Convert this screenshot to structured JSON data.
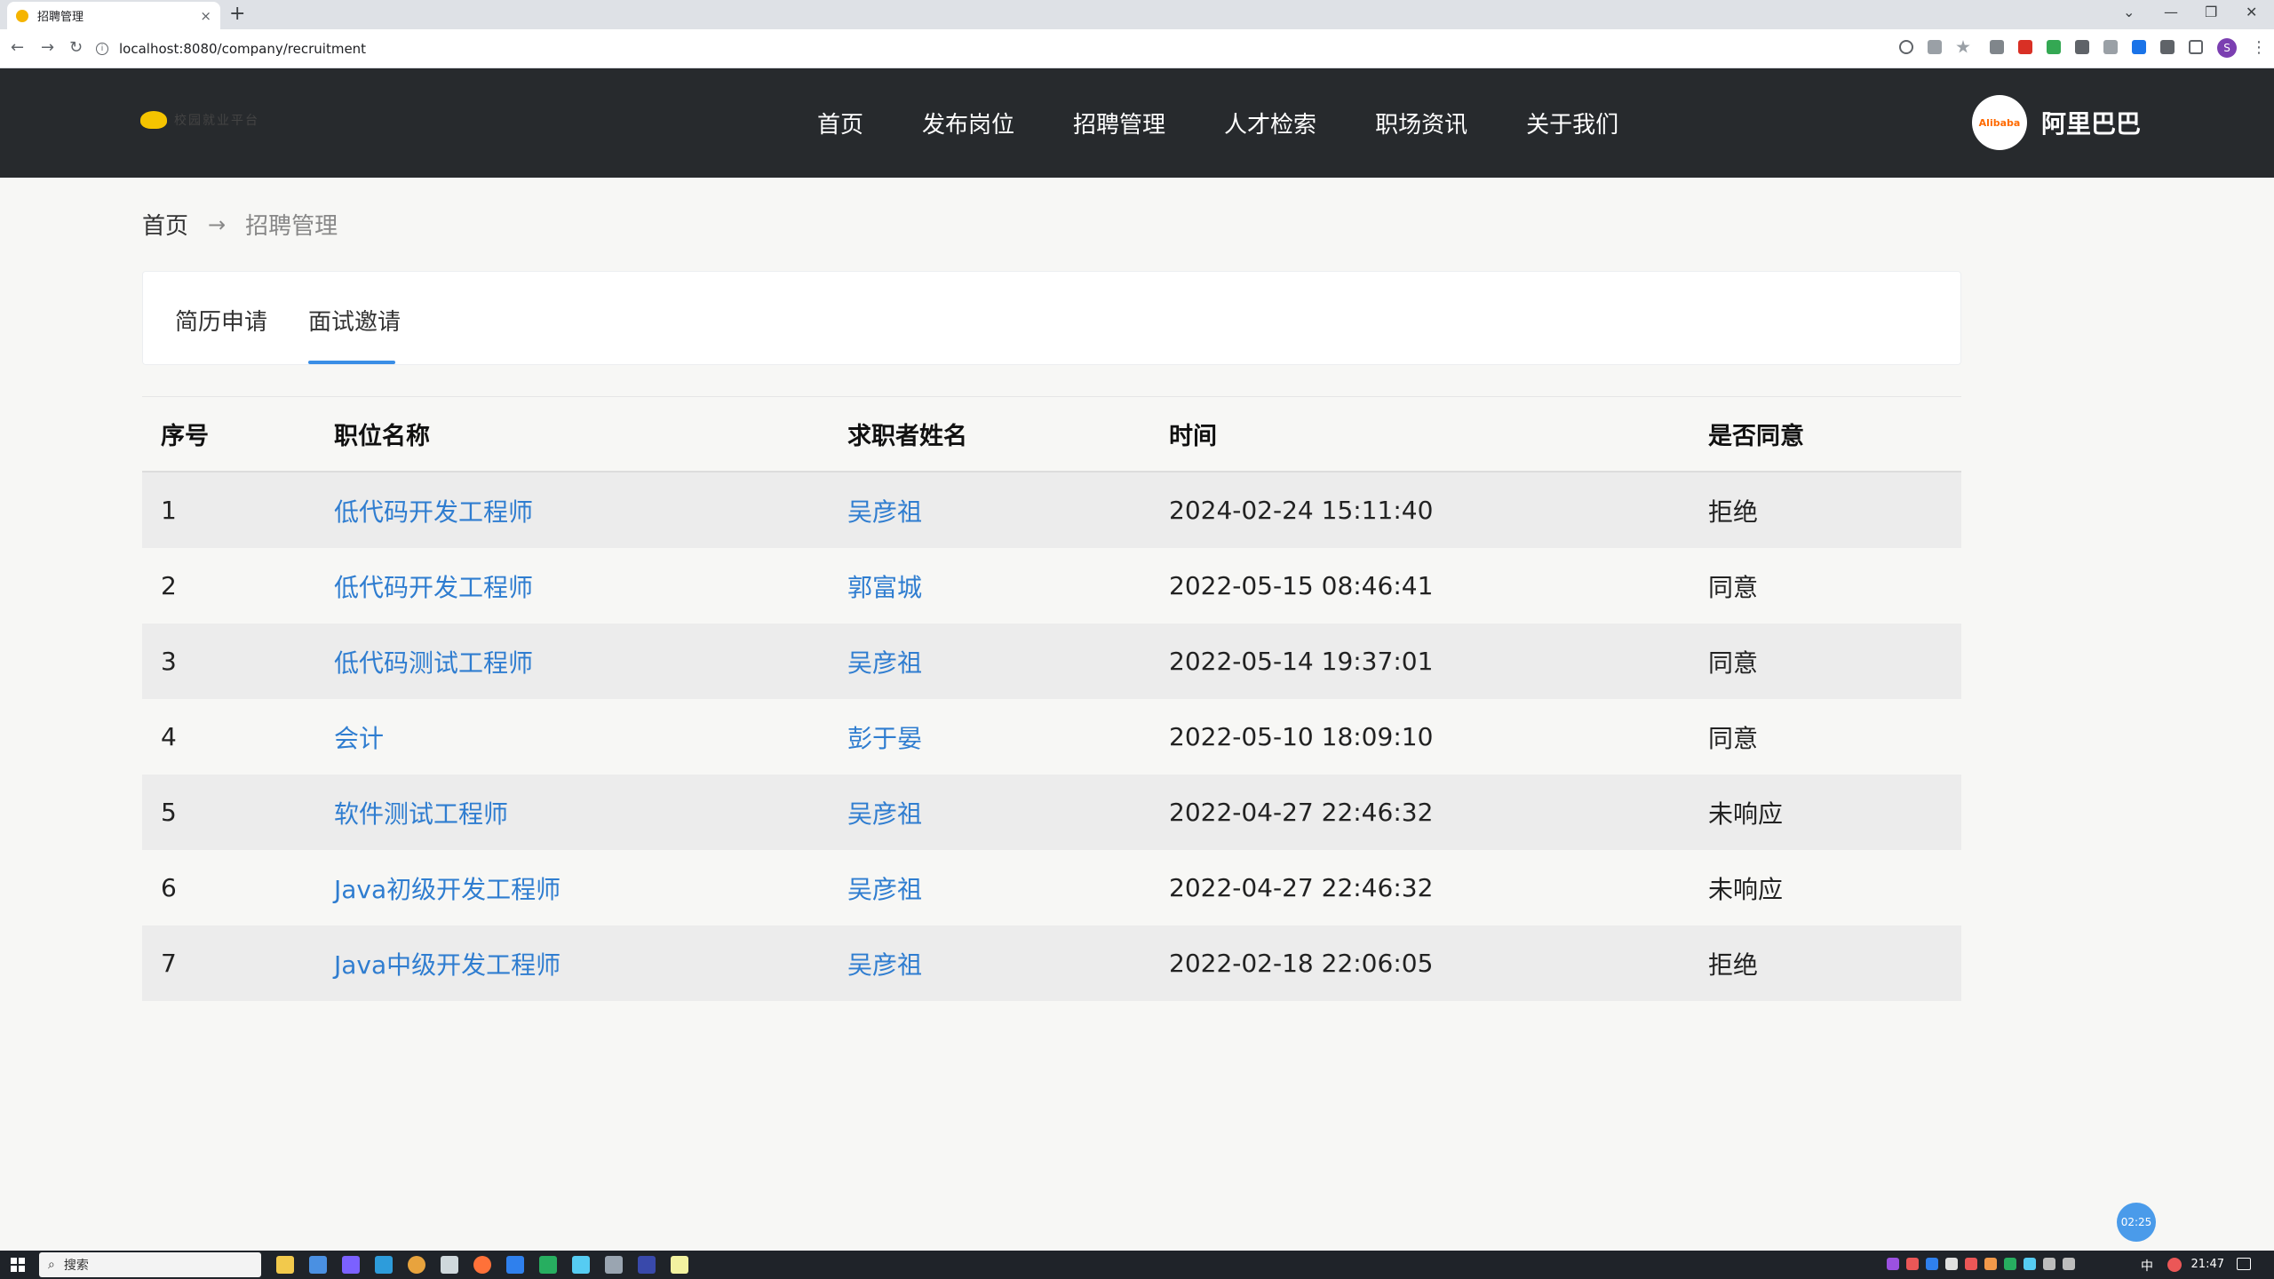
{
  "browser": {
    "tab_title": "招聘管理",
    "tab_close": "×",
    "new_tab": "+",
    "address": "localhost:8080/company/recruitment",
    "back": "←",
    "forward": "→",
    "reload": "↻",
    "profile_initial": "S",
    "minimize": "—",
    "restore": "❐",
    "close": "✕",
    "tabs_dropdown": "⌄"
  },
  "site": {
    "logo_text": "校园就业平台",
    "nav": [
      "首页",
      "发布岗位",
      "招聘管理",
      "人才检索",
      "职场资讯",
      "关于我们"
    ],
    "company_logo_text": "Alibaba",
    "company_name": "阿里巴巴"
  },
  "breadcrumb": {
    "home": "首页",
    "separator": "→",
    "current": "招聘管理"
  },
  "tabs": {
    "items": [
      "简历申请",
      "面试邀请"
    ],
    "active_index": 1
  },
  "table": {
    "headers": [
      "序号",
      "职位名称",
      "求职者姓名",
      "时间",
      "是否同意"
    ],
    "rows": [
      {
        "no": "1",
        "position": "低代码开发工程师",
        "applicant": "吴彦祖",
        "time": "2024-02-24 15:11:40",
        "status": "拒绝"
      },
      {
        "no": "2",
        "position": "低代码开发工程师",
        "applicant": "郭富城",
        "time": "2022-05-15 08:46:41",
        "status": "同意"
      },
      {
        "no": "3",
        "position": "低代码测试工程师",
        "applicant": "吴彦祖",
        "time": "2022-05-14 19:37:01",
        "status": "同意"
      },
      {
        "no": "4",
        "position": "会计",
        "applicant": "彭于晏",
        "time": "2022-05-10 18:09:10",
        "status": "同意"
      },
      {
        "no": "5",
        "position": "软件测试工程师",
        "applicant": "吴彦祖",
        "time": "2022-04-27 22:46:32",
        "status": "未响应"
      },
      {
        "no": "6",
        "position": "Java初级开发工程师",
        "applicant": "吴彦祖",
        "time": "2022-04-27 22:46:32",
        "status": "未响应"
      },
      {
        "no": "7",
        "position": "Java中级开发工程师",
        "applicant": "吴彦祖",
        "time": "2022-02-18 22:06:05",
        "status": "拒绝"
      }
    ]
  },
  "timer": "02:25",
  "taskbar": {
    "search_placeholder": "搜索",
    "search_icon": "⌕",
    "time": "21:47",
    "ime": "中"
  },
  "colors": {
    "header_bg": "#272a2d",
    "link": "#2f7dd0",
    "tab_underline": "#3a8ee6",
    "row_alt": "#ececec"
  }
}
